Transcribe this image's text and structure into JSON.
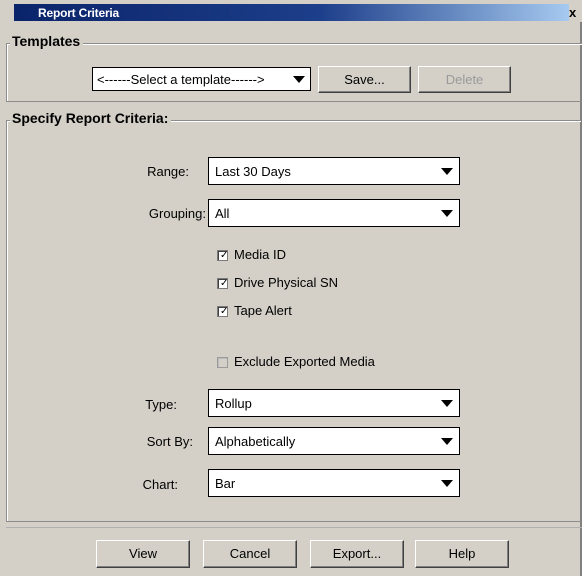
{
  "window": {
    "title": "Report Criteria",
    "close_label": "x"
  },
  "templates": {
    "legend": "Templates",
    "select_value": "<------Select a template------>",
    "save_label": "Save...",
    "delete_label": "Delete",
    "delete_enabled": false
  },
  "criteria": {
    "legend": "Specify Report Criteria:",
    "range": {
      "label": "Range:",
      "value": "Last 30 Days"
    },
    "grouping": {
      "label": "Grouping:",
      "value": "All"
    },
    "checkboxes": [
      {
        "label": "Media ID",
        "checked": true
      },
      {
        "label": "Drive Physical SN",
        "checked": true
      },
      {
        "label": "Tape Alert",
        "checked": true
      }
    ],
    "exclude": {
      "label": "Exclude Exported Media",
      "checked": false
    },
    "type": {
      "label": "Type:",
      "value": "Rollup"
    },
    "sort_by": {
      "label": "Sort By:",
      "value": "Alphabetically"
    },
    "chart": {
      "label": "Chart:",
      "value": "Bar"
    }
  },
  "buttons": {
    "view": "View",
    "cancel": "Cancel",
    "export": "Export...",
    "help": "Help"
  },
  "colors": {
    "title_bar": "#0a246a",
    "face": "#d4d0c8",
    "disabled_text": "#9a9a9a"
  }
}
